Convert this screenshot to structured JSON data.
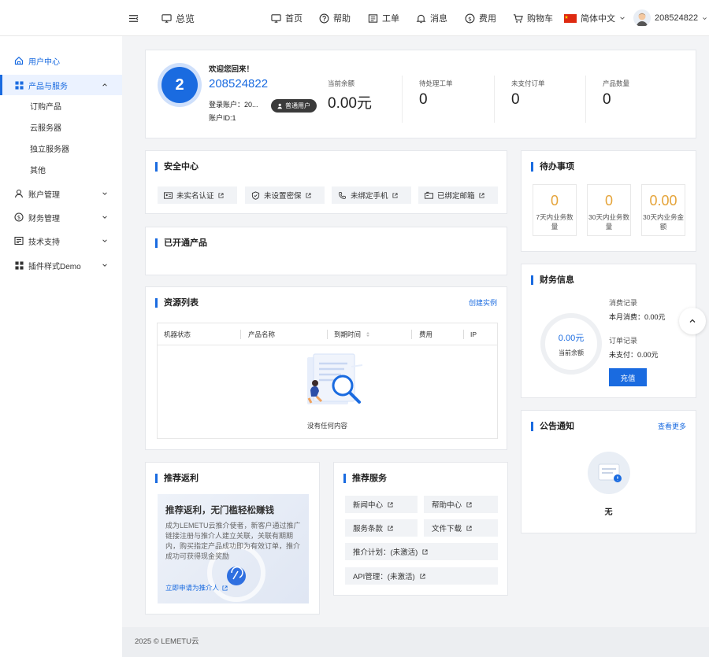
{
  "header": {
    "overview": "总览",
    "nav": [
      {
        "label": "首页",
        "icon": "monitor-icon"
      },
      {
        "label": "帮助",
        "icon": "help-circle-icon"
      },
      {
        "label": "工单",
        "icon": "ticket-icon"
      },
      {
        "label": "消息",
        "icon": "bell-icon"
      },
      {
        "label": "费用",
        "icon": "dollar-icon"
      },
      {
        "label": "购物车",
        "icon": "cart-icon"
      }
    ],
    "language": "简体中文",
    "username": "208524822"
  },
  "sidebar": {
    "items": [
      {
        "label": "用户中心"
      },
      {
        "label": "产品与服务"
      },
      {
        "label": "账户管理"
      },
      {
        "label": "财务管理"
      },
      {
        "label": "技术支持"
      },
      {
        "label": "插件样式Demo"
      }
    ],
    "sub_items": [
      "订购产品",
      "云服务器",
      "独立服务器",
      "其他"
    ]
  },
  "account": {
    "level": "2",
    "welcome": "欢迎您回来！",
    "username": "208524822",
    "login_account": "登录账户：20...",
    "account_id": "账户ID:1",
    "badge": "普通用户",
    "stats": [
      {
        "label": "当前余额",
        "value": "0.00元"
      },
      {
        "label": "待处理工单",
        "value": "0"
      },
      {
        "label": "未支付订单",
        "value": "0"
      },
      {
        "label": "产品数量",
        "value": "0"
      }
    ]
  },
  "security": {
    "title": "安全中心",
    "items": [
      "未实名认证",
      "未设置密保",
      "未绑定手机",
      "已绑定邮箱"
    ]
  },
  "products": {
    "title": "已开通产品"
  },
  "resources": {
    "title": "资源列表",
    "create": "创建实例",
    "columns": [
      "机器状态",
      "产品名称",
      "到期时间",
      "费用",
      "IP"
    ],
    "empty": "没有任何内容"
  },
  "referral": {
    "title": "推荐返利",
    "headline": "推荐返利，无门槛轻松赚钱",
    "body": "成为LEMETU云推介使者，新客户通过推广链接注册与推介人建立关联，关联有期期内，购买指定产品成功即为有效订单，推介成功可获得现金奖励",
    "apply": "立即申请为推介人"
  },
  "services": {
    "title": "推荐服务",
    "items": [
      "新闻中心",
      "帮助中心",
      "服务条款",
      "文件下载",
      "推介计划：(未激活)",
      "API管理：(未激活)"
    ]
  },
  "todo": {
    "title": "待办事项",
    "items": [
      {
        "value": "0",
        "label": "7天内业务数量"
      },
      {
        "value": "0",
        "label": "30天内业务数量"
      },
      {
        "value": "0.00",
        "label": "30天内业务金额"
      }
    ]
  },
  "finance": {
    "title": "财务信息",
    "balance": "0.00元",
    "balance_label": "当前余额",
    "consume_label": "消费记录",
    "month_consume": "本月消费：0.00元",
    "order_label": "订单记录",
    "unpaid": "未支付：0.00元",
    "recharge": "充值"
  },
  "notice": {
    "title": "公告通知",
    "more": "查看更多",
    "empty": "无"
  },
  "footer": {
    "copyright": "2025 © LEMETU云"
  },
  "colors": {
    "accent": "#1a6be0",
    "warning": "#e5a43a"
  }
}
